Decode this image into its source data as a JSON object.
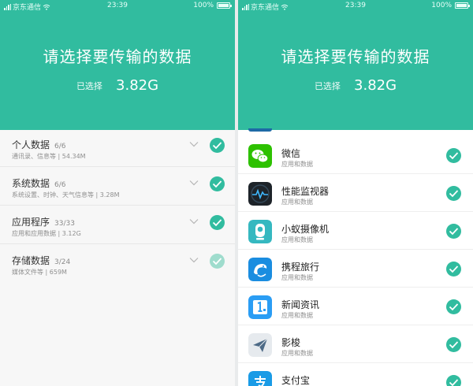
{
  "colors": {
    "accent": "#31bc9f",
    "accent_light": "#9fdccd"
  },
  "status_bar": {
    "carrier": "京东通信",
    "time": "23:39",
    "battery": "100%"
  },
  "header": {
    "title": "请选择要传输的数据",
    "selected_label": "已选择",
    "selected_size": "3.82G"
  },
  "categories": [
    {
      "name": "个人数据",
      "count": "6/6",
      "detail": "通讯录、信息等 | 54.34M",
      "check": "checked"
    },
    {
      "name": "系统数据",
      "count": "6/6",
      "detail": "系统设置、时钟、天气信息等 | 3.28M",
      "check": "checked"
    },
    {
      "name": "应用程序",
      "count": "33/33",
      "detail": "应用和应用数据 | 3.12G",
      "check": "checked"
    },
    {
      "name": "存储数据",
      "count": "3/24",
      "detail": "媒体文件等 | 659M",
      "check": "partial"
    }
  ],
  "apps": [
    {
      "name": "微信",
      "sub": "应用和数据",
      "icon": "wechat-icon"
    },
    {
      "name": "性能监视器",
      "sub": "应用和数据",
      "icon": "performance-monitor-icon"
    },
    {
      "name": "小蚁摄像机",
      "sub": "应用和数据",
      "icon": "yi-camera-icon"
    },
    {
      "name": "携程旅行",
      "sub": "应用和数据",
      "icon": "ctrip-dolphin-icon"
    },
    {
      "name": "新闻资讯",
      "sub": "应用和数据",
      "icon": "news-icon"
    },
    {
      "name": "影梭",
      "sub": "应用和数据",
      "icon": "paper-plane-icon"
    },
    {
      "name": "支付宝",
      "sub": "",
      "icon": "alipay-icon"
    }
  ]
}
